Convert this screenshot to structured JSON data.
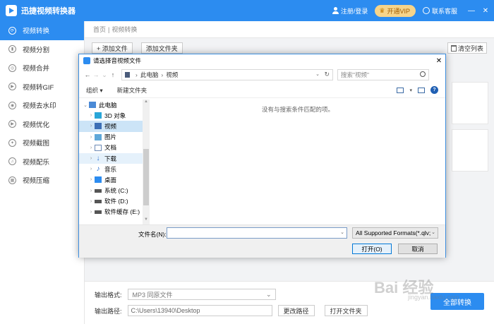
{
  "app": {
    "title": "迅捷视频转换器",
    "login": "注册/登录",
    "vip": "开通VIP",
    "service": "联系客服",
    "min": "—",
    "close": "✕"
  },
  "sidebar": {
    "items": [
      {
        "label": "视频转换",
        "icon": "⟳"
      },
      {
        "label": "视频分割",
        "icon": "▮"
      },
      {
        "label": "视频合并",
        "icon": "◎"
      },
      {
        "label": "视频转GIF",
        "icon": "▶"
      },
      {
        "label": "视频去水印",
        "icon": "◉"
      },
      {
        "label": "视频优化",
        "icon": "▶"
      },
      {
        "label": "视频截图",
        "icon": "✦"
      },
      {
        "label": "视频配乐",
        "icon": "♫"
      },
      {
        "label": "视频压缩",
        "icon": "▦"
      }
    ]
  },
  "main": {
    "breadcrumb_home": "首页",
    "breadcrumb_sep": "|",
    "breadcrumb_current": "视频转换",
    "add_file": "+ 添加文件",
    "add_folder": "添加文件夹",
    "clear_list": "清空列表"
  },
  "bottom": {
    "format_label": "输出格式:",
    "format_value": "MP3  同原文件",
    "path_label": "输出路径:",
    "path_value": "C:\\Users\\13940\\Desktop",
    "change_path": "更改路径",
    "open_folder": "打开文件夹",
    "convert_all": "全部转换"
  },
  "dialog": {
    "title": "请选择音视频文件",
    "close": "✕",
    "address_root": "此电脑",
    "address_sep": "›",
    "address_current": "视频",
    "search_placeholder": "搜索\"视频\"",
    "organize": "组织 ▾",
    "new_folder": "新建文件夹",
    "empty_message": "没有与搜索条件匹配的项。",
    "filename_label": "文件名(N):",
    "filter_value": "All Supported Formats(*.qlv;",
    "open_button": "打开(O)",
    "cancel_button": "取消",
    "tree": [
      {
        "label": "此电脑",
        "icon": "pc",
        "twisty": "⌄",
        "indent": 4
      },
      {
        "label": "3D 对象",
        "icon": "cube",
        "twisty": "›",
        "indent": 12
      },
      {
        "label": "视频",
        "icon": "video",
        "twisty": "›",
        "indent": 12,
        "selected": true
      },
      {
        "label": "图片",
        "icon": "pic",
        "twisty": "›",
        "indent": 12
      },
      {
        "label": "文档",
        "icon": "doc",
        "twisty": "›",
        "indent": 12
      },
      {
        "label": "下载",
        "icon": "down",
        "twisty": "›",
        "indent": 12,
        "hover": true
      },
      {
        "label": "音乐",
        "icon": "music",
        "twisty": "›",
        "indent": 12
      },
      {
        "label": "桌面",
        "icon": "desk",
        "twisty": "›",
        "indent": 12
      },
      {
        "label": "系统 (C:)",
        "icon": "drv",
        "twisty": "›",
        "indent": 12
      },
      {
        "label": "软件 (D:)",
        "icon": "drv",
        "twisty": "›",
        "indent": 12
      },
      {
        "label": "软件缓存 (E:)",
        "icon": "drv",
        "twisty": "›",
        "indent": 12
      }
    ]
  },
  "watermark": {
    "text": "Bai 经验",
    "sub": "jingyan.baidu.com"
  }
}
